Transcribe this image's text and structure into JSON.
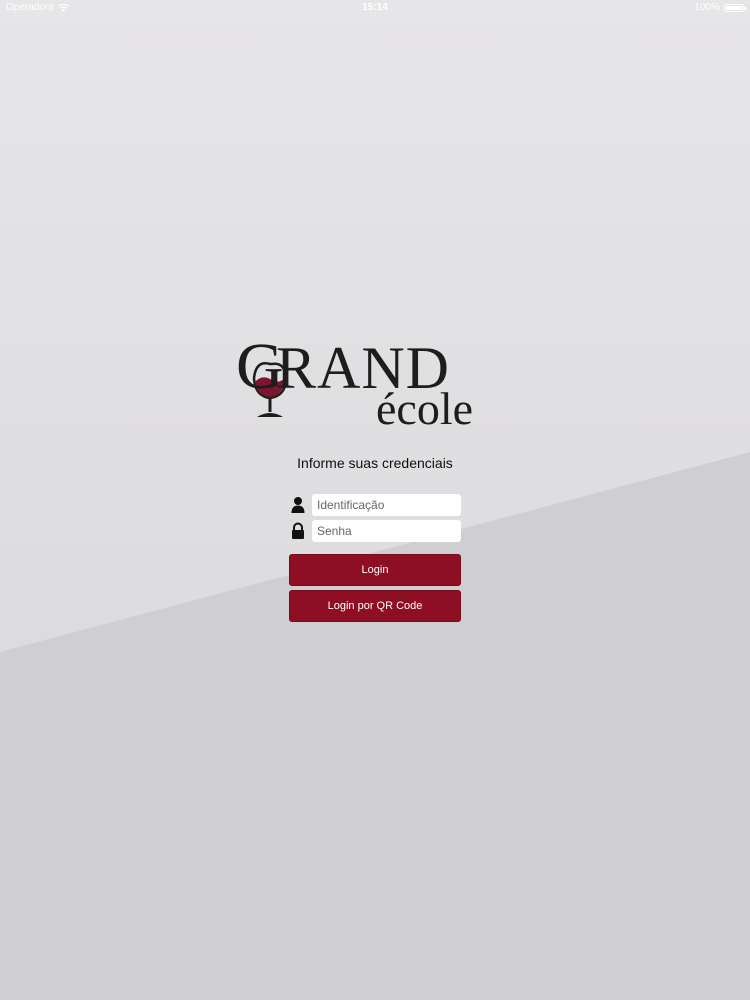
{
  "status_bar": {
    "carrier": "Operadora",
    "wifi_icon": "wifi-icon",
    "time": "15:14",
    "battery_percent": "100%",
    "battery_icon": "battery-icon"
  },
  "logo": {
    "grand_g": "G",
    "grand_rest": "RAND",
    "ecole": "école",
    "glass_icon": "wine-glass-icon",
    "wine_color": "#7b1530"
  },
  "login": {
    "instructions": "Informe suas credenciais",
    "identification_placeholder": "Identificação",
    "identification_value": "",
    "password_placeholder": "Senha",
    "password_value": "",
    "user_icon": "user-icon",
    "lock_icon": "lock-icon",
    "login_button": "Login",
    "qr_button": "Login por QR Code"
  },
  "colors": {
    "button_bg": "#8e0e23",
    "background_light": "#e3e2e4",
    "background_dark": "#cfcfd1"
  }
}
